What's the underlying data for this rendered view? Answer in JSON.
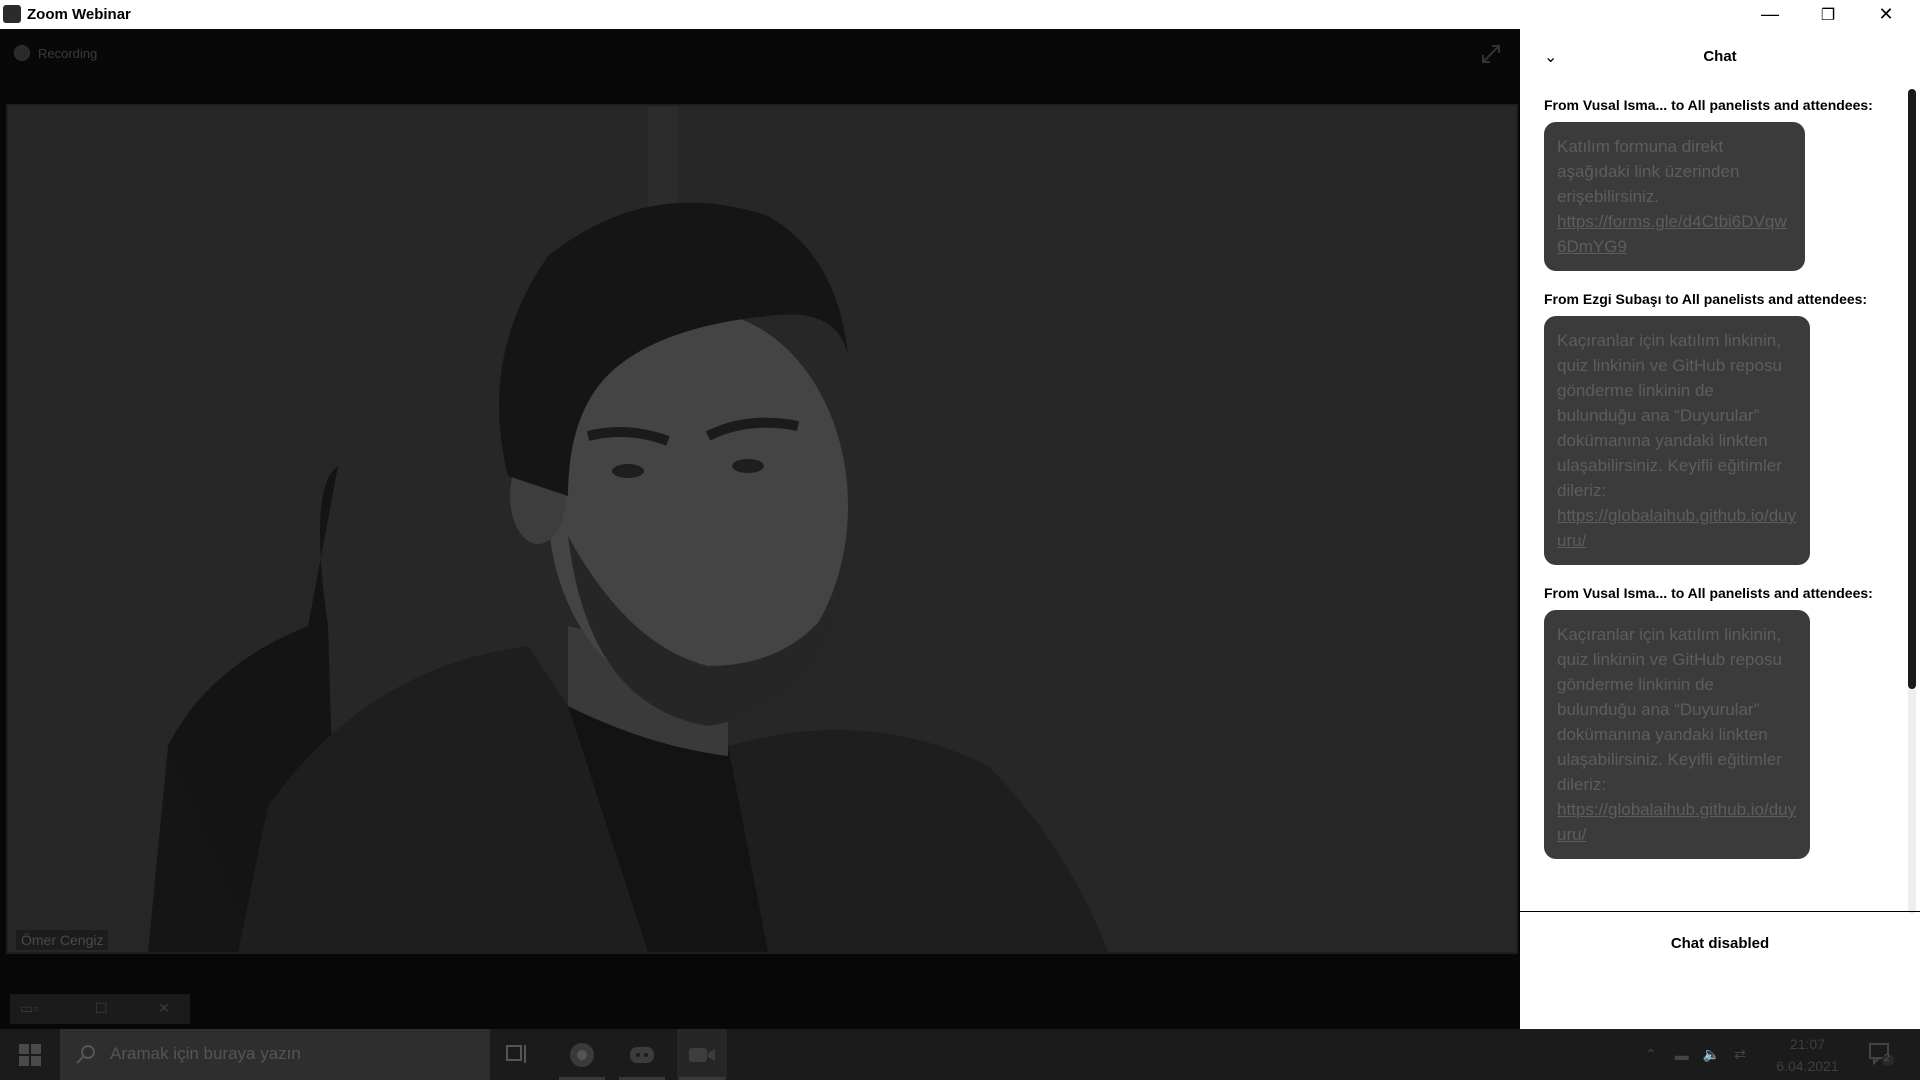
{
  "window": {
    "title": "Zoom Webinar",
    "minimize": "—",
    "restore": "❐",
    "close": "✕"
  },
  "video": {
    "recording_label": "Recording",
    "participant_name": "Ömer Cengiz"
  },
  "chat": {
    "title": "Chat",
    "messages": [
      {
        "from": "From Vusal Isma...  to All panelists and attendees:",
        "text": "Katılım formuna direkt aşağıdaki link üzerinden erişebilirsiniz.",
        "link": "https://forms.gle/d4Ctbi6DVqw6DmYG9"
      },
      {
        "from": "From Ezgi Subaşı to All panelists and attendees:",
        "text": "Kaçıranlar için katılım linkinin, quiz linkinin ve GitHub reposu gönderme linkinin de bulunduğu ana “Duyurular” dokümanına yandaki linkten ulaşabilirsiniz. Keyifli eğitimler dileriz:",
        "link": "https://globalaihub.github.io/duyuru/"
      },
      {
        "from": "From Vusal Isma...  to All panelists and attendees:",
        "text": "Kaçıranlar için katılım linkinin, quiz linkinin ve GitHub reposu gönderme linkinin de bulunduğu ana “Duyurular” dokümanına yandaki linkten ulaşabilirsiniz. Keyifli eğitimler dileriz:",
        "link": "https://globalaihub.github.io/duyuru/"
      }
    ],
    "status": "Chat disabled"
  },
  "taskbar": {
    "search_placeholder": "Aramak için buraya yazın",
    "time": "21:07",
    "date": "6.04.2021",
    "notification_count": "2",
    "apps": [
      "chrome-icon",
      "discord-icon",
      "zoom-icon"
    ]
  }
}
